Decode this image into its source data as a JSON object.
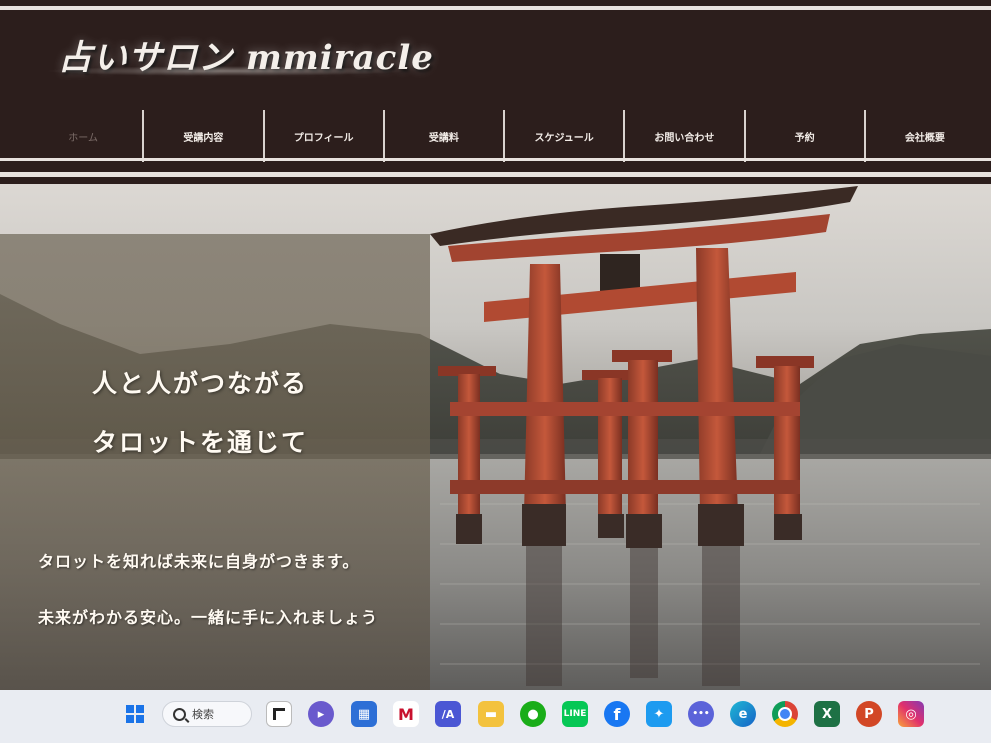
{
  "site": {
    "logo_text": "占いサロン mmiracle",
    "nav": [
      "ホーム",
      "受講内容",
      "プロフィール",
      "受講料",
      "スケジュール",
      "お問い合わせ",
      "予約",
      "会社概要"
    ]
  },
  "hero": {
    "headline_1": "人と人がつながる",
    "headline_2": "タロットを通じて",
    "subline_1": "タロットを知れば未来に自身がつきます。",
    "subline_2": "未来がわかる安心。一緒に手に入れましょう"
  },
  "taskbar": {
    "search_label": "検索",
    "icons": [
      "windows-start-icon",
      "task-view-icon",
      "chat-icon",
      "store-icon",
      "mcafee-icon",
      "app-icon",
      "file-explorer-icon",
      "wechat-icon",
      "line-icon",
      "facebook-icon",
      "twitter-icon",
      "dots-app-icon",
      "edge-icon",
      "chrome-icon",
      "excel-icon",
      "powerpoint-icon",
      "instagram-icon"
    ]
  },
  "colors": {
    "header_bg": "#2c1e1c",
    "torii_red": "#b5462e",
    "taskbar_bg": "#e9ecf2"
  }
}
